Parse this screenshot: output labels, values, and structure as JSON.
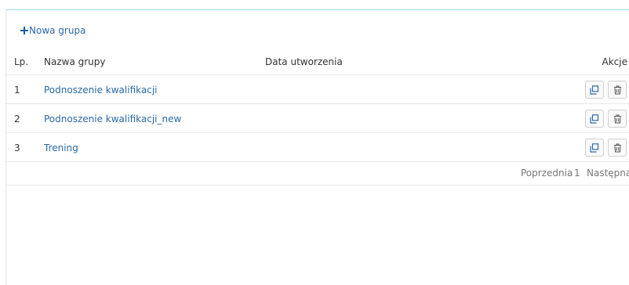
{
  "toolbar": {
    "new_group_label": "Nowa grupa"
  },
  "table": {
    "headers": {
      "lp": "Lp.",
      "name": "Nazwa grupy",
      "date": "Data utworzenia",
      "actions": "Akcje"
    },
    "rows": [
      {
        "lp": "1",
        "name": "Podnoszenie kwalifikacji",
        "date": ""
      },
      {
        "lp": "2",
        "name": "Podnoszenie kwalifikacji_new",
        "date": ""
      },
      {
        "lp": "3",
        "name": "Trening",
        "date": ""
      }
    ],
    "row_action_icons": [
      "copy-icon",
      "trash-icon"
    ]
  },
  "pagination": {
    "prev": "Poprzednia",
    "current": "1",
    "next": "Następna"
  },
  "colors": {
    "link": "#2a6aa8",
    "panel_top_border": "#a9d4ec"
  }
}
